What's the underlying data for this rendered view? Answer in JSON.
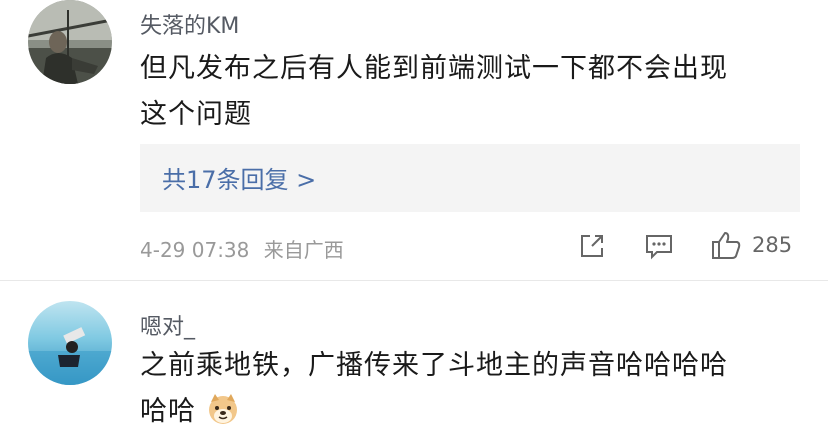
{
  "comments": [
    {
      "username": "失落的KM",
      "text_line1": "但凡发布之后有人能到前端测试一下都不会出现",
      "text_line2": "这个问题",
      "replies_label": "共17条回复 >",
      "timestamp": "4-29 07:38",
      "location": "来自广西",
      "like_count": "285",
      "avatar_icon": "avatar-photo"
    },
    {
      "username": "嗯对_",
      "text_line1": "之前乘地铁，广播传来了斗地主的声音哈哈哈哈",
      "text_line2": "哈哈",
      "emoji_icon": "doge-emoji",
      "avatar_icon": "avatar-ocean"
    }
  ],
  "icons": {
    "share": "share-icon",
    "comment": "comment-icon",
    "like": "like-icon"
  }
}
